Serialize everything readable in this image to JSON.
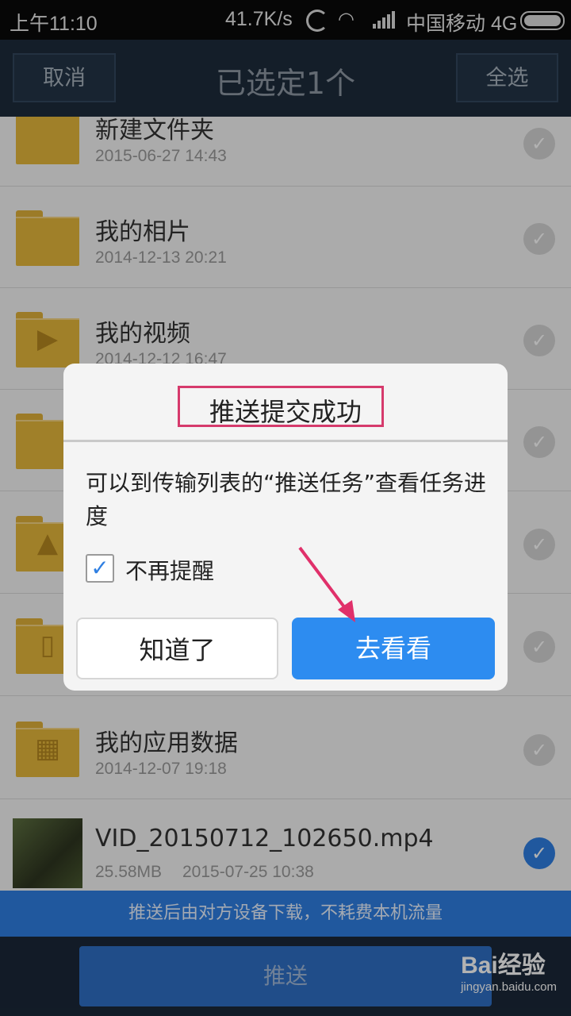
{
  "status_bar": {
    "time": "上午11:10",
    "net_speed": "41.7K/s",
    "carrier": "中国移动 4G"
  },
  "header": {
    "cancel_label": "取消",
    "title": "已选定1个",
    "select_all_label": "全选"
  },
  "list": {
    "items": [
      {
        "name": "新建文件夹",
        "meta": "2015-06-27  14:43",
        "icon": "folder-icon",
        "checked": false
      },
      {
        "name": "我的相片",
        "meta": "2014-12-13  20:21",
        "icon": "folder-icon",
        "checked": false
      },
      {
        "name": "我的视频",
        "meta": "2014-12-12  16:47",
        "icon": "video-folder-icon",
        "checked": false
      },
      {
        "name": "",
        "meta": "",
        "icon": "folder-icon",
        "checked": false
      },
      {
        "name": "",
        "meta": "",
        "icon": "image-folder-icon",
        "checked": false
      },
      {
        "name": "",
        "meta": "",
        "icon": "device-folder-icon",
        "checked": false
      },
      {
        "name": "我的应用数据",
        "meta": "2014-12-07  19:18",
        "icon": "apps-folder-icon",
        "checked": false
      },
      {
        "name": "VID_20150712_102650.mp4",
        "size": "25.58MB",
        "meta": "2015-07-25  10:38",
        "icon": "video-thumbnail",
        "checked": true
      }
    ]
  },
  "banner": "推送后由对方设备下载，不耗费本机流量",
  "bottom": {
    "push_label": "推送"
  },
  "watermark": {
    "brand": "Bai经验",
    "url": "jingyan.baidu.com"
  },
  "dialog": {
    "title": "推送提交成功",
    "message": "可以到传输列表的“推送任务”查看任务进度",
    "checkbox_label": "不再提醒",
    "checkbox_checked": true,
    "ok_label": "知道了",
    "go_label": "去看看"
  },
  "colors": {
    "accent": "#2d8cf0",
    "header_bg": "#1d2b3c",
    "highlight_box": "#d63a6c",
    "folder": "#e6b83b"
  }
}
